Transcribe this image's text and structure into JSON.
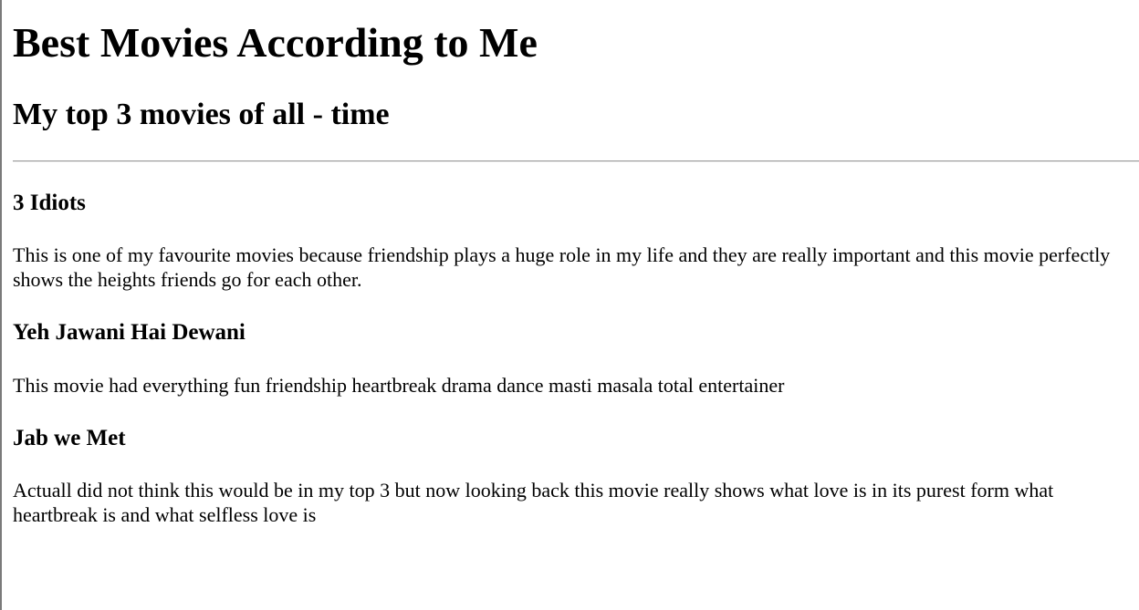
{
  "page": {
    "title": "Best Movies According to Me",
    "subtitle": "My top 3 movies of all - time"
  },
  "movies": [
    {
      "title": "3 Idiots",
      "description": "This is one of my favourite movies because friendship plays a huge role in my life and they are really important and this movie perfectly shows the heights friends go for each other."
    },
    {
      "title": "Yeh Jawani Hai Dewani",
      "description": "This movie had everything fun friendship heartbreak drama dance masti masala total entertainer"
    },
    {
      "title": "Jab we Met",
      "description": "Actuall did not think this would be in my top 3 but now looking back this movie really shows what love is in its purest form what heartbreak is and what selfless love is"
    }
  ]
}
